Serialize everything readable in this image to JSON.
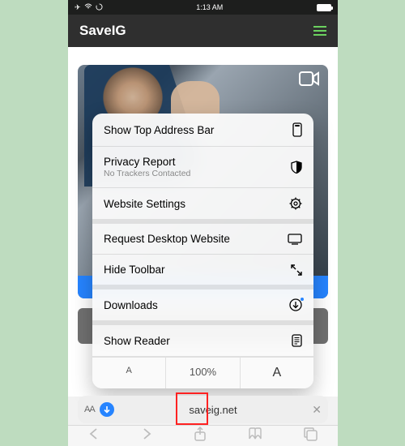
{
  "statusbar": {
    "time": "1:13 AM"
  },
  "header": {
    "title": "SaveIG"
  },
  "menu": {
    "topAddress": "Show Top Address Bar",
    "privacyTitle": "Privacy Report",
    "privacySub": "No Trackers Contacted",
    "settings": "Website Settings",
    "desktop": "Request Desktop Website",
    "hideToolbar": "Hide Toolbar",
    "downloads": "Downloads",
    "reader": "Show Reader",
    "smallA": "A",
    "zoom": "100%",
    "bigA": "A"
  },
  "address": {
    "aa": "AA",
    "url": "saveig.net"
  }
}
